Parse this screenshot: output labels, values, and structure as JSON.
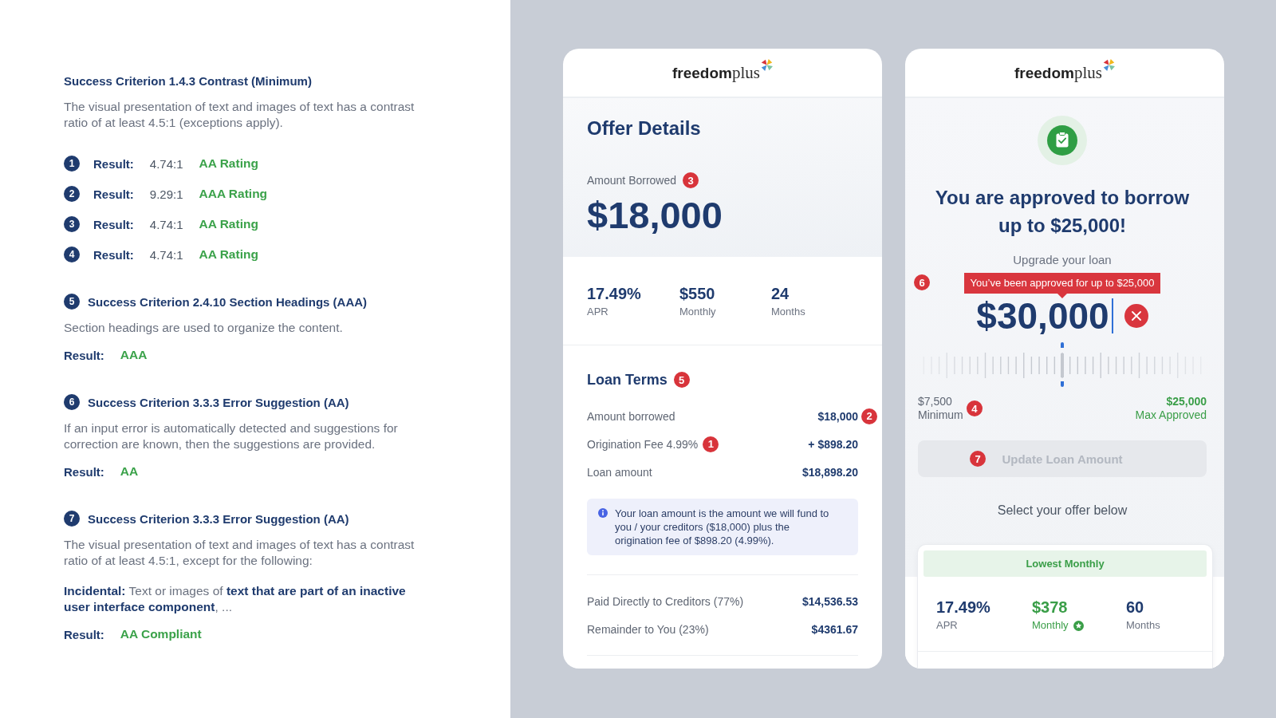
{
  "criteria_panel": {
    "criteria": [
      {
        "title": "Success Criterion 1.4.3 Contrast (Minimum)",
        "paragraphs": [
          "The visual presentation of text and images of text has a contrast ratio of at least 4.5:1 (exceptions apply)."
        ],
        "results": [
          {
            "badge": "1",
            "label": "Result:",
            "ratio": "4.74:1",
            "rating": "AA Rating"
          },
          {
            "badge": "2",
            "label": "Result:",
            "ratio": "9.29:1",
            "rating": "AAA Rating"
          },
          {
            "badge": "3",
            "label": "Result:",
            "ratio": "4.74:1",
            "rating": "AA Rating"
          },
          {
            "badge": "4",
            "label": "Result:",
            "ratio": "4.74:1",
            "rating": "AA Rating"
          }
        ]
      },
      {
        "badge": "5",
        "title": "Success Criterion 2.4.10 Section Headings (AAA)",
        "paragraphs": [
          "Section headings are used to organize the content."
        ],
        "results": [
          {
            "label": "Result:",
            "rating": "AAA"
          }
        ]
      },
      {
        "badge": "6",
        "title": "Success Criterion 3.3.3 Error Suggestion (AA)",
        "paragraphs": [
          "If an input error is automatically detected and suggestions for correction are known, then the suggestions are provided."
        ],
        "results": [
          {
            "label": "Result:",
            "rating": "AA"
          }
        ]
      },
      {
        "badge": "7",
        "title": "Success Criterion 3.3.3 Error Suggestion (AA)",
        "paragraphs": [
          "The visual presentation of text and images of text has a contrast ratio of at least 4.5:1, except for the following:",
          "**Incidental:** Text or images of **text that are part of an inactive user interface component**, ..."
        ],
        "results": [
          {
            "label": "Result:",
            "rating": "AA Compliant"
          }
        ]
      }
    ]
  },
  "offer_screen": {
    "logo": {
      "bold": "freedom",
      "light": "plus"
    },
    "title": "Offer Details",
    "amount": {
      "label": "Amount Borrowed",
      "badge": "3",
      "value": "$18,000"
    },
    "stats": [
      {
        "value": "17.49%",
        "label": "APR"
      },
      {
        "value": "$550",
        "label": "Monthly"
      },
      {
        "value": "24",
        "label": "Months"
      }
    ],
    "loan_terms": {
      "title": "Loan Terms",
      "badge": "5",
      "rows": [
        {
          "label": "Amount borrowed",
          "value": "$18,000",
          "value_badge": "2"
        },
        {
          "label": "Origination Fee 4.99%",
          "label_badge": "1",
          "value": "+ $898.20"
        },
        {
          "label": "Loan amount",
          "value": "$18,898.20"
        }
      ],
      "info": "Your loan amount is the amount we will fund to you / your creditors ($18,000) plus the origination fee of $898.20 (4.99%).",
      "payout_rows": [
        {
          "label": "Paid Directly to Creditors (77%)",
          "value": "$14,536.53"
        },
        {
          "label": "Remainder to You (23%)",
          "value": "$4361.67"
        }
      ]
    }
  },
  "approval_screen": {
    "logo": {
      "bold": "freedom",
      "light": "plus"
    },
    "headline": "You are approved to borrow up to $25,000!",
    "subheading": "Upgrade your loan",
    "error_badge": "6",
    "tooltip": "You’ve been approved for up to $25,000",
    "amount_field": {
      "value": "$30,000",
      "focused": true
    },
    "slider": {
      "level": 0.5
    },
    "range": {
      "min": {
        "value": "$7,500",
        "label": "Minimum",
        "badge": "4"
      },
      "max": {
        "value": "$25,000",
        "label": "Max Approved"
      }
    },
    "update_button": {
      "label": "Update Loan Amount",
      "disabled": true,
      "badge": "7"
    },
    "prompt": "Select your offer below",
    "offer_card": {
      "tag": "Lowest Monthly",
      "stats": [
        {
          "value": "17.49%",
          "label": "APR",
          "highlighted": false
        },
        {
          "value": "$378",
          "label": "Monthly",
          "highlighted": true
        },
        {
          "value": "60",
          "label": "Months",
          "highlighted": false
        }
      ]
    }
  }
}
